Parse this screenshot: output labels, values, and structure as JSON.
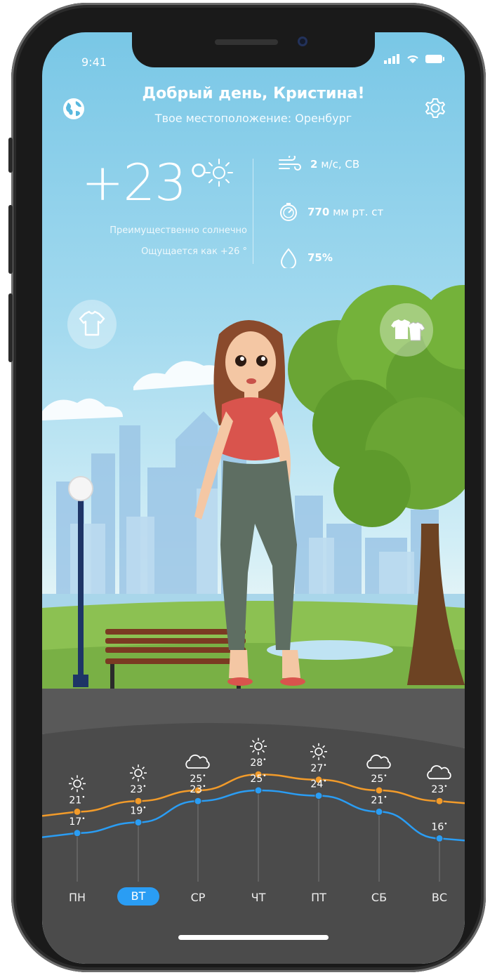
{
  "status": {
    "time": "9:41"
  },
  "header": {
    "greeting": "Добрый день, Кристина!",
    "location": "Твое местоположение: Оренбург"
  },
  "current": {
    "temperature": "+23°",
    "condition": "Преимущественно солнечно",
    "feels_like": "Ощущается как +26 °",
    "wind_value": "2",
    "wind_unit": "м/с, СВ",
    "pressure_value": "770",
    "pressure_unit": "мм рт. ст",
    "humidity": "75%"
  },
  "icons": {
    "globe": "globe-icon",
    "settings": "gear-icon",
    "shirt": "tshirt-outline-icon",
    "wardrobe": "wardrobe-icon",
    "wind": "wind-icon",
    "pressure": "pressure-gauge-icon",
    "humidity": "droplet-icon"
  },
  "colors": {
    "accent": "#2a9df4",
    "day_line": "#f29b2a",
    "night_line": "#2a9df4",
    "panel": "#4b4b4b"
  },
  "forecast": {
    "days": [
      {
        "label": "ПН",
        "icon": "sun",
        "high": "21",
        "low": "17",
        "active": false
      },
      {
        "label": "ВТ",
        "icon": "sun",
        "high": "23",
        "low": "19",
        "active": true
      },
      {
        "label": "СР",
        "icon": "cloud",
        "high": "25",
        "low": "23",
        "active": false
      },
      {
        "label": "ЧТ",
        "icon": "sun",
        "high": "28",
        "low": "25",
        "active": false
      },
      {
        "label": "ПТ",
        "icon": "sun",
        "high": "27",
        "low": "24",
        "active": false
      },
      {
        "label": "СБ",
        "icon": "cloud",
        "high": "25",
        "low": "21",
        "active": false
      },
      {
        "label": "ВС",
        "icon": "cloud",
        "high": "23",
        "low": "16",
        "active": false
      }
    ]
  }
}
